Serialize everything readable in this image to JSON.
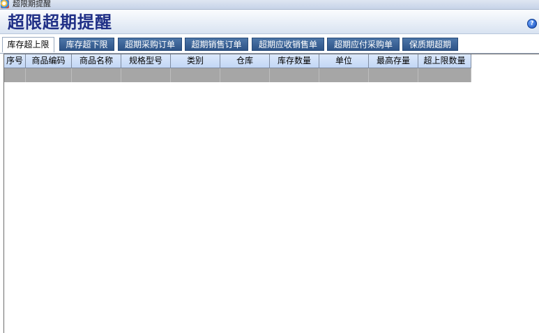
{
  "window": {
    "title": "超限期提醒"
  },
  "header": {
    "title": "超限超期提醒",
    "help_glyph": "?"
  },
  "tabs": [
    {
      "label": "库存超上限",
      "active": true
    },
    {
      "label": "库存超下限",
      "active": false
    },
    {
      "label": "超期采购订单",
      "active": false
    },
    {
      "label": "超期销售订单",
      "active": false
    },
    {
      "label": "超期应收销售单",
      "active": false
    },
    {
      "label": "超期应付采购单",
      "active": false
    },
    {
      "label": "保质期超期",
      "active": false
    }
  ],
  "grid": {
    "columns": [
      "序号",
      "商品编码",
      "商品名称",
      "规格型号",
      "类别",
      "仓库",
      "库存数量",
      "单位",
      "最高存量",
      "超上限数量"
    ],
    "rows": [
      [
        "",
        "",
        "",
        "",
        "",
        "",
        "",
        "",
        "",
        ""
      ]
    ]
  },
  "colors": {
    "tab_bg": "#2e5488",
    "header_bg": "#c3d7f5",
    "selected_row": "#a6a6a6",
    "title_color": "#1f2f86"
  },
  "icons": {
    "app": "app-logo-icon",
    "help": "help-icon"
  }
}
